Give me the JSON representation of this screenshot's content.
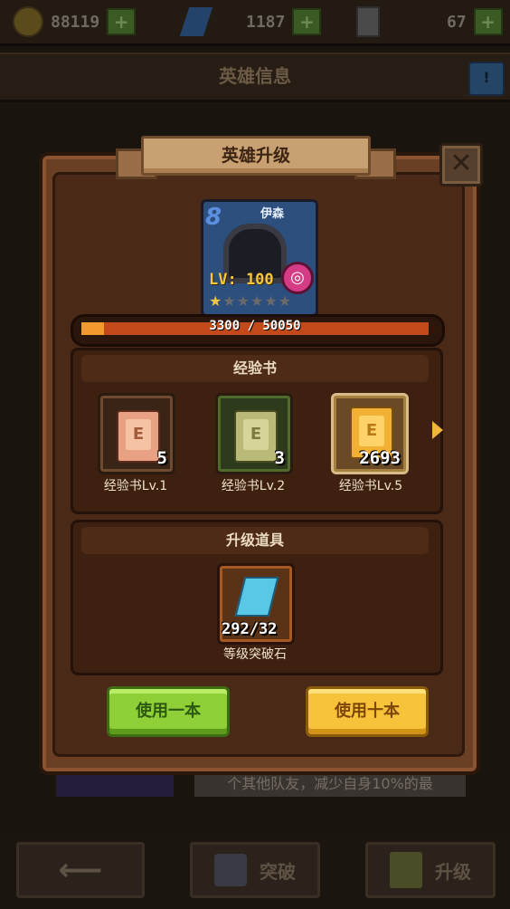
{
  "resources": {
    "gold": "88119",
    "gems": "1187",
    "tickets": "67"
  },
  "page": {
    "title": "英雄信息",
    "help_symbol": "!"
  },
  "modal": {
    "title": "英雄升级",
    "close_symbol": "✕"
  },
  "hero": {
    "name": "伊森",
    "rank": "8",
    "level": "LV: 100",
    "stars_total": 6,
    "stars_filled": 1,
    "exp_current": 3300,
    "exp_max": 50050,
    "exp_text": "3300 / 50050"
  },
  "exp_books": {
    "heading": "经验书",
    "items": [
      {
        "label": "经验书Lv.1",
        "count": "5"
      },
      {
        "label": "经验书Lv.2",
        "count": "3"
      },
      {
        "label": "经验书Lv.5",
        "count": "2693"
      }
    ]
  },
  "upgrade_items": {
    "heading": "升级道具",
    "item": {
      "label": "等级突破石",
      "count": "292/32"
    }
  },
  "buttons": {
    "use_one": "使用一本",
    "use_ten": "使用十本"
  },
  "background": {
    "description": "个其他队友，减少自身10%的最",
    "breakthrough": "突破",
    "upgrade": "升级",
    "back_arrow": "⟵"
  },
  "colors": {
    "accent_green": "#8fcf38",
    "accent_yellow": "#f6c33a",
    "exp_fill": "#f29a2e",
    "panel_brown": "#6b3f24"
  }
}
